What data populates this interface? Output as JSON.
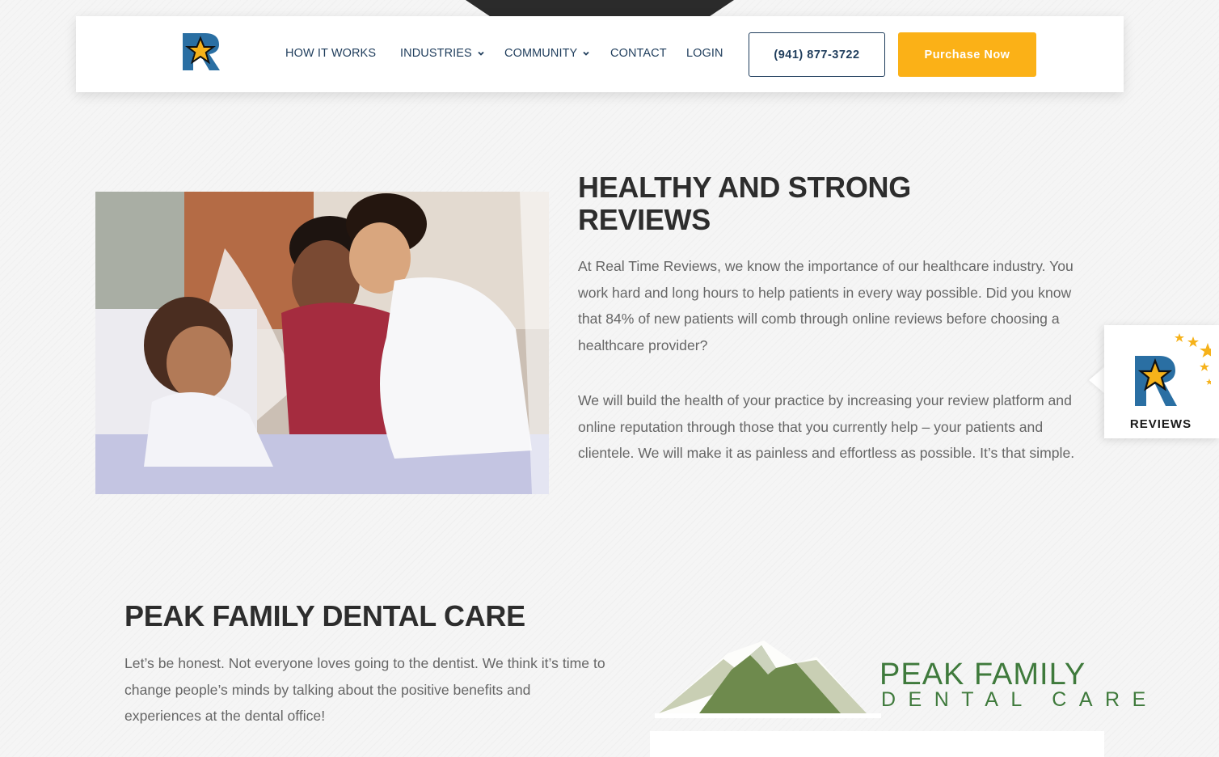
{
  "header": {
    "nav": {
      "how_it_works": "HOW IT WORKS",
      "industries": "INDUSTRIES",
      "community": "COMMUNITY",
      "contact": "CONTACT",
      "login": "LOGIN"
    },
    "phone": "(941) 877-3722",
    "purchase": "Purchase Now",
    "colors": {
      "navy": "#1f3d5c",
      "accent": "#fbb117"
    },
    "icons": [
      "real-time-reviews-logo-icon",
      "chevron-down-icon"
    ]
  },
  "healthy_section": {
    "title_line1": "HEALTHY AND STRONG",
    "title_line2": "REVIEWS",
    "paragraph1": "At Real Time Reviews, we know the importance of our healthcare industry. You work hard and long hours to help patients in every way possible. Did you know that 84% of new patients will comb through online reviews before choosing a healthcare provider?",
    "paragraph2": "We will build the health of your practice by increasing your review platform and online reputation through those that you currently help – your patients and clientele. We will make it as painless and effortless as possible. It’s that simple."
  },
  "reviews_badge": {
    "label": "REVIEWS"
  },
  "peak_section": {
    "title": "PEAK FAMILY DENTAL CARE",
    "paragraph": "Let’s be honest. Not everyone loves going to the dentist. We think it’s time to change people’s minds by talking about the positive benefits and experiences at the dental office!",
    "logo_line1": "PEAK FAMILY",
    "logo_line2": "DENTAL CARE",
    "logo_color": "#3f7a3c"
  }
}
